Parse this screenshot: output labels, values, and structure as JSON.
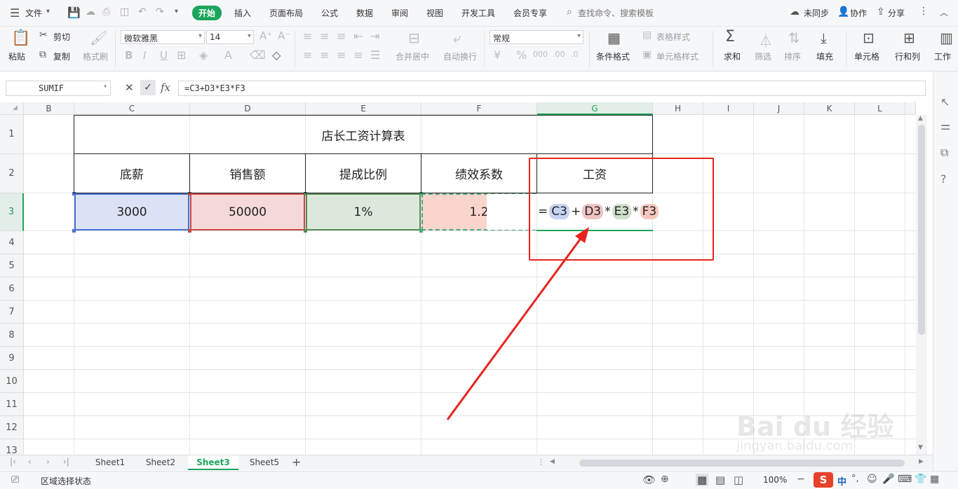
{
  "titlebar": {
    "file_menu": "文件",
    "tabs": [
      "开始",
      "插入",
      "页面布局",
      "公式",
      "数据",
      "审阅",
      "视图",
      "开发工具",
      "会员专享"
    ],
    "search_placeholder": "查找命令、搜索模板",
    "sync": "未同步",
    "collab": "协作",
    "share": "分享"
  },
  "ribbon": {
    "paste": "粘贴",
    "cut": "剪切",
    "copy": "复制",
    "format_painter": "格式刷",
    "font_name": "微软雅黑",
    "font_size": "14",
    "merge_center": "合并居中",
    "wrap_text": "自动换行",
    "number_format": "常规",
    "cond_format": "条件格式",
    "table_style": "表格样式",
    "cell_style": "单元格样式",
    "sum": "求和",
    "filter": "筛选",
    "sort": "排序",
    "fill": "填充",
    "cell": "单元格",
    "rowcol": "行和列",
    "worksheet": "工作"
  },
  "formula_bar": {
    "name_box": "SUMIF",
    "fx": "fx",
    "formula": "=C3+D3*E3*F3"
  },
  "columns": [
    "B",
    "C",
    "D",
    "E",
    "F",
    "G",
    "H",
    "I",
    "J",
    "K",
    "L"
  ],
  "rows": [
    "1",
    "2",
    "3",
    "4",
    "5",
    "6",
    "7",
    "8",
    "9",
    "10",
    "11",
    "12",
    "13"
  ],
  "sheet": {
    "title": "店长工资计算表",
    "headers": [
      "底薪",
      "销售额",
      "提成比例",
      "绩效系数",
      "工资"
    ],
    "values": [
      "3000",
      "50000",
      "1%",
      "1.2"
    ],
    "editing": {
      "eq": "=",
      "refs": [
        "C3",
        "D3",
        "E3",
        "F3"
      ],
      "ops": [
        "+",
        "*",
        "*"
      ]
    }
  },
  "sheet_tabs": [
    "Sheet1",
    "Sheet2",
    "Sheet3",
    "Sheet5"
  ],
  "status": {
    "mode": "区域选择状态",
    "zoom": "100%",
    "ime": "中"
  },
  "watermark": {
    "brand": "Bai du 经验",
    "url": "jingyan.baidu.com"
  },
  "colors": {
    "accent": "#1ba55b",
    "ref_c3": "#dbe2f5",
    "ref_d3": "#f5d9d9",
    "ref_e3": "#dde8dc",
    "ref_f3": "#f9d5cc",
    "annotation_red": "#e8231f"
  }
}
